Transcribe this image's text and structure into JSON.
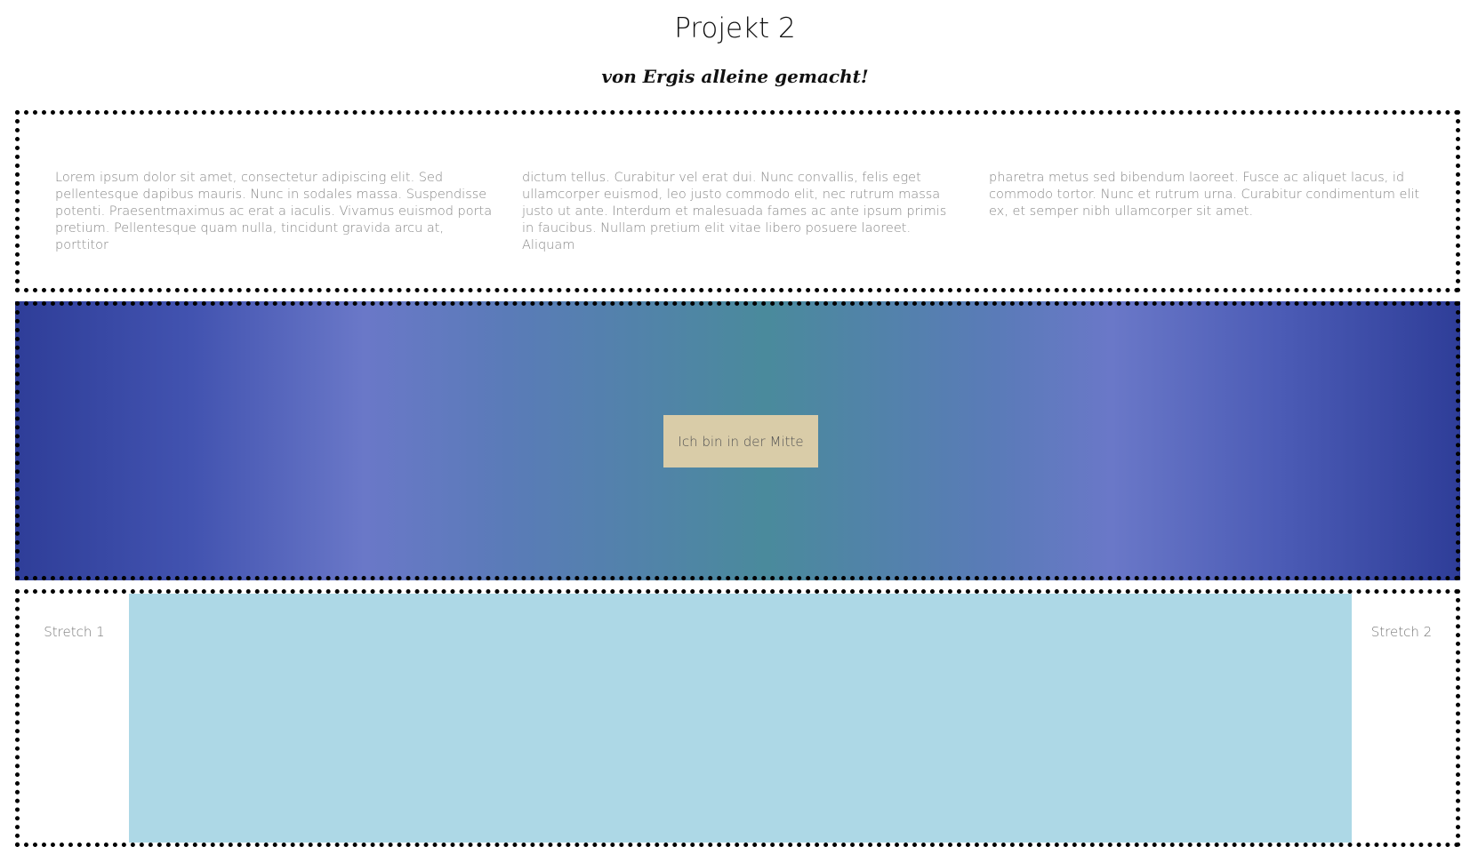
{
  "header": {
    "title": "Projekt 2",
    "subtitle": "von Ergis alleine gemacht!"
  },
  "text_section": {
    "columns": [
      "Lorem ipsum dolor sit amet, consectetur adipiscing elit. Sed pellentesque dapibus mauris. Nunc in sodales massa. Suspendisse potenti. Praesentmaximus ac erat a iaculis. Vivamus euismod porta pretium. Pellentesque quam nulla, tincidunt gravida arcu at, porttitor",
      "dictum tellus. Curabitur vel erat dui. Nunc convallis, felis eget ullamcorper euismod, leo justo commodo elit, nec rutrum massa justo ut ante. Interdum et malesuada fames ac ante ipsum primis in faucibus. Nullam pretium elit vitae libero posuere laoreet. Aliquam",
      "pharetra metus sed bibendum laoreet. Fusce ac aliquet lacus, id commodo tortor. Nunc et rutrum urna. Curabitur condimentum elit ex, et semper nibh ullamcorper sit amet."
    ]
  },
  "gradient_section": {
    "center_label": "Ich bin in der Mitte"
  },
  "stretch_section": {
    "left_label": "Stretch 1",
    "right_label": "Stretch 2"
  },
  "colors": {
    "center_box": "#d9cca8",
    "stretch_middle": "#add8e6",
    "gradient_edge": "#2f3e99",
    "gradient_center": "#4a8a9c"
  }
}
